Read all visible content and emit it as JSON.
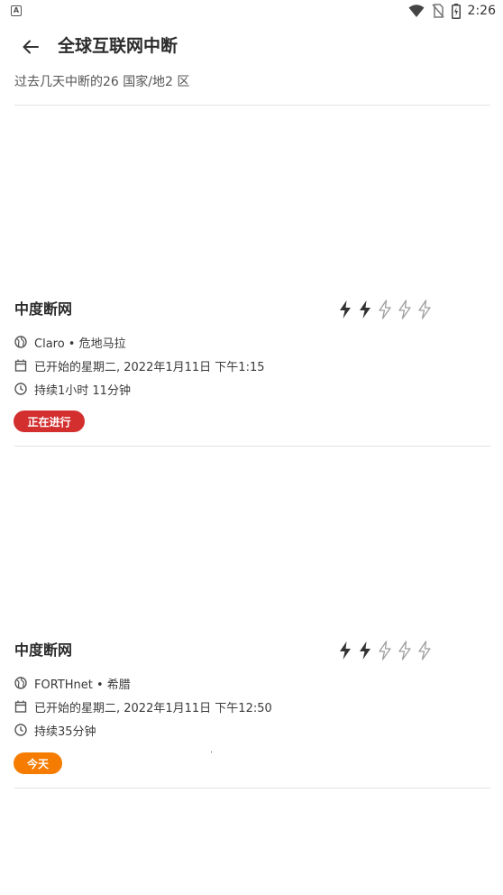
{
  "status_bar": {
    "time": "2:26",
    "left_icon": "A"
  },
  "header": {
    "title": "全球互联网中断",
    "back_icon": "arrow-left-icon"
  },
  "subtitle": "过去几天中断的26 国家/地2 区",
  "outages": [
    {
      "severity_label": "中度断网",
      "severity_level": 2,
      "severity_max": 5,
      "provider_line": "Claro • 危地马拉",
      "started_line": "已开始的星期二, 2022年1月11日 下午1:15",
      "duration_line": "持续1小时 11分钟",
      "status_badge": "正在进行",
      "badge_color": "#d32f2f"
    },
    {
      "severity_label": "中度断网",
      "severity_level": 2,
      "severity_max": 5,
      "provider_line": "FORTHnet • 希腊",
      "started_line": "已开始的星期二, 2022年1月11日 下午12:50",
      "duration_line": "持续35分钟",
      "status_badge": "今天",
      "badge_color": "#f57c00"
    }
  ],
  "colors": {
    "divider": "#e3e3e3",
    "bolt_filled": "#333333",
    "bolt_outline": "#9e9e9e"
  }
}
